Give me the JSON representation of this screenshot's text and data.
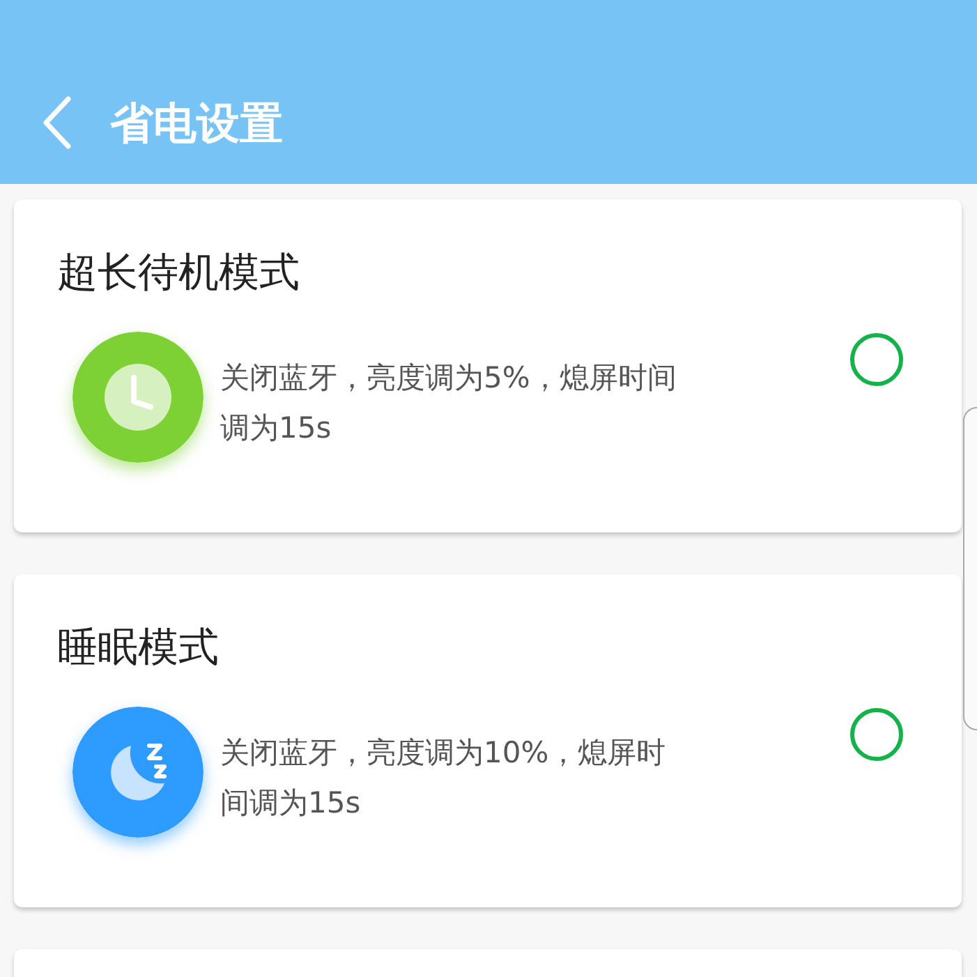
{
  "header": {
    "title": "省电设置"
  },
  "modes": [
    {
      "title": "超长待机模式",
      "kind": "clock",
      "description": "关闭蓝牙，亮度调为5%，熄屏时间调为15s",
      "selected": false
    },
    {
      "title": "睡眠模式",
      "kind": "moon",
      "description": "关闭蓝牙，亮度调为10%，熄屏时间调为15s",
      "selected": false
    }
  ]
}
